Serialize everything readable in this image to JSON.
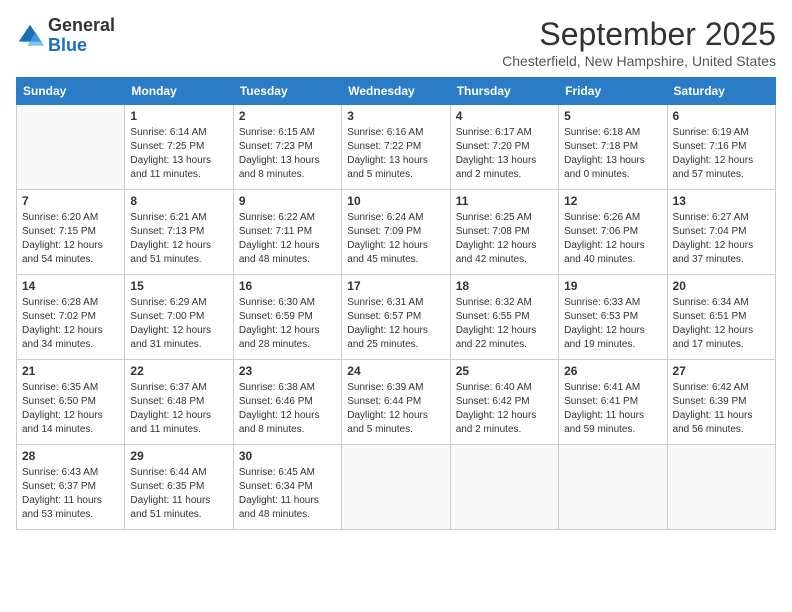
{
  "logo": {
    "general": "General",
    "blue": "Blue"
  },
  "header": {
    "month": "September 2025",
    "location": "Chesterfield, New Hampshire, United States"
  },
  "weekdays": [
    "Sunday",
    "Monday",
    "Tuesday",
    "Wednesday",
    "Thursday",
    "Friday",
    "Saturday"
  ],
  "weeks": [
    [
      {
        "day": "",
        "info": ""
      },
      {
        "day": "1",
        "info": "Sunrise: 6:14 AM\nSunset: 7:25 PM\nDaylight: 13 hours\nand 11 minutes."
      },
      {
        "day": "2",
        "info": "Sunrise: 6:15 AM\nSunset: 7:23 PM\nDaylight: 13 hours\nand 8 minutes."
      },
      {
        "day": "3",
        "info": "Sunrise: 6:16 AM\nSunset: 7:22 PM\nDaylight: 13 hours\nand 5 minutes."
      },
      {
        "day": "4",
        "info": "Sunrise: 6:17 AM\nSunset: 7:20 PM\nDaylight: 13 hours\nand 2 minutes."
      },
      {
        "day": "5",
        "info": "Sunrise: 6:18 AM\nSunset: 7:18 PM\nDaylight: 13 hours\nand 0 minutes."
      },
      {
        "day": "6",
        "info": "Sunrise: 6:19 AM\nSunset: 7:16 PM\nDaylight: 12 hours\nand 57 minutes."
      }
    ],
    [
      {
        "day": "7",
        "info": "Sunrise: 6:20 AM\nSunset: 7:15 PM\nDaylight: 12 hours\nand 54 minutes."
      },
      {
        "day": "8",
        "info": "Sunrise: 6:21 AM\nSunset: 7:13 PM\nDaylight: 12 hours\nand 51 minutes."
      },
      {
        "day": "9",
        "info": "Sunrise: 6:22 AM\nSunset: 7:11 PM\nDaylight: 12 hours\nand 48 minutes."
      },
      {
        "day": "10",
        "info": "Sunrise: 6:24 AM\nSunset: 7:09 PM\nDaylight: 12 hours\nand 45 minutes."
      },
      {
        "day": "11",
        "info": "Sunrise: 6:25 AM\nSunset: 7:08 PM\nDaylight: 12 hours\nand 42 minutes."
      },
      {
        "day": "12",
        "info": "Sunrise: 6:26 AM\nSunset: 7:06 PM\nDaylight: 12 hours\nand 40 minutes."
      },
      {
        "day": "13",
        "info": "Sunrise: 6:27 AM\nSunset: 7:04 PM\nDaylight: 12 hours\nand 37 minutes."
      }
    ],
    [
      {
        "day": "14",
        "info": "Sunrise: 6:28 AM\nSunset: 7:02 PM\nDaylight: 12 hours\nand 34 minutes."
      },
      {
        "day": "15",
        "info": "Sunrise: 6:29 AM\nSunset: 7:00 PM\nDaylight: 12 hours\nand 31 minutes."
      },
      {
        "day": "16",
        "info": "Sunrise: 6:30 AM\nSunset: 6:59 PM\nDaylight: 12 hours\nand 28 minutes."
      },
      {
        "day": "17",
        "info": "Sunrise: 6:31 AM\nSunset: 6:57 PM\nDaylight: 12 hours\nand 25 minutes."
      },
      {
        "day": "18",
        "info": "Sunrise: 6:32 AM\nSunset: 6:55 PM\nDaylight: 12 hours\nand 22 minutes."
      },
      {
        "day": "19",
        "info": "Sunrise: 6:33 AM\nSunset: 6:53 PM\nDaylight: 12 hours\nand 19 minutes."
      },
      {
        "day": "20",
        "info": "Sunrise: 6:34 AM\nSunset: 6:51 PM\nDaylight: 12 hours\nand 17 minutes."
      }
    ],
    [
      {
        "day": "21",
        "info": "Sunrise: 6:35 AM\nSunset: 6:50 PM\nDaylight: 12 hours\nand 14 minutes."
      },
      {
        "day": "22",
        "info": "Sunrise: 6:37 AM\nSunset: 6:48 PM\nDaylight: 12 hours\nand 11 minutes."
      },
      {
        "day": "23",
        "info": "Sunrise: 6:38 AM\nSunset: 6:46 PM\nDaylight: 12 hours\nand 8 minutes."
      },
      {
        "day": "24",
        "info": "Sunrise: 6:39 AM\nSunset: 6:44 PM\nDaylight: 12 hours\nand 5 minutes."
      },
      {
        "day": "25",
        "info": "Sunrise: 6:40 AM\nSunset: 6:42 PM\nDaylight: 12 hours\nand 2 minutes."
      },
      {
        "day": "26",
        "info": "Sunrise: 6:41 AM\nSunset: 6:41 PM\nDaylight: 11 hours\nand 59 minutes."
      },
      {
        "day": "27",
        "info": "Sunrise: 6:42 AM\nSunset: 6:39 PM\nDaylight: 11 hours\nand 56 minutes."
      }
    ],
    [
      {
        "day": "28",
        "info": "Sunrise: 6:43 AM\nSunset: 6:37 PM\nDaylight: 11 hours\nand 53 minutes."
      },
      {
        "day": "29",
        "info": "Sunrise: 6:44 AM\nSunset: 6:35 PM\nDaylight: 11 hours\nand 51 minutes."
      },
      {
        "day": "30",
        "info": "Sunrise: 6:45 AM\nSunset: 6:34 PM\nDaylight: 11 hours\nand 48 minutes."
      },
      {
        "day": "",
        "info": ""
      },
      {
        "day": "",
        "info": ""
      },
      {
        "day": "",
        "info": ""
      },
      {
        "day": "",
        "info": ""
      }
    ]
  ]
}
